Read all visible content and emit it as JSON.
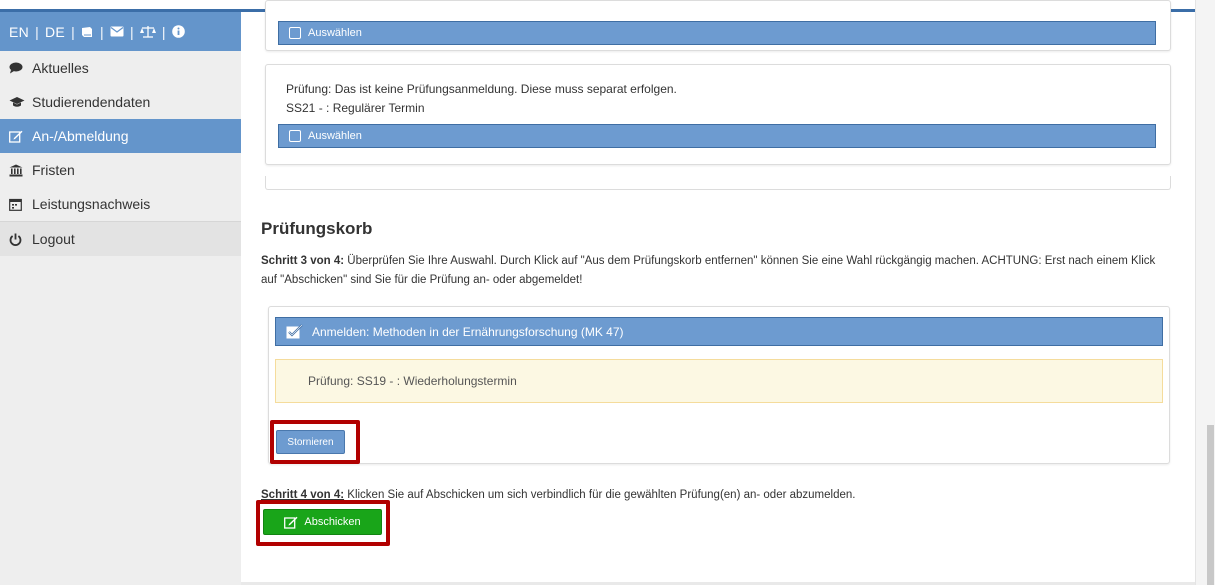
{
  "colors": {
    "accent_blue": "#6495cb",
    "button_blue": "#6d9bd0",
    "submit_green": "#19a519",
    "highlight_red": "#b10000",
    "warning_bg": "#fcf8e3"
  },
  "sidebar": {
    "lang": {
      "en": "EN",
      "de": "DE",
      "sep": "|",
      "icons": [
        "book-icon",
        "envelope-icon",
        "balance-scale-icon",
        "info-icon"
      ]
    },
    "items": [
      {
        "label": "Aktuelles",
        "icon": "comment-icon"
      },
      {
        "label": "Studierendendaten",
        "icon": "graduation-cap-icon"
      },
      {
        "label": "An-/Abmeldung",
        "icon": "edit-icon"
      },
      {
        "label": "Fristen",
        "icon": "bank-icon"
      },
      {
        "label": "Leistungsnachweis",
        "icon": "calendar-icon"
      },
      {
        "label": "Logout",
        "icon": "power-icon"
      }
    ]
  },
  "exam_cards": {
    "top_select_label": "Auswählen",
    "card2_line1": "Prüfung: Das ist keine Prüfungsanmeldung. Diese muss separat erfolgen.",
    "card2_line2": "SS21 - : Regulärer Termin",
    "card2_select_label": "Auswählen"
  },
  "basket": {
    "title": "Prüfungskorb",
    "step3_bold": "Schritt 3 von 4:",
    "step3_text": " Überprüfen Sie Ihre Auswahl. Durch Klick auf \"Aus dem Prüfungskorb entfernen\" können Sie eine Wahl rückgängig machen. ACHTUNG: Erst nach einem Klick",
    "step3_text2": "auf \"Abschicken\" sind Sie für die Prüfung an- oder abgemeldet!",
    "entry_header": "Anmelden: Methoden in der Ernährungsforschung (MK 47)",
    "entry_detail": "Prüfung: SS19 - : Wiederholungstermin",
    "cancel_button": "Stornieren",
    "step4_bold": "Schritt 4 von 4:",
    "step4_text": " Klicken Sie auf Abschicken um sich verbindlich für die gewählten Prüfung(en) an- oder abzumelden.",
    "submit_button": "Abschicken"
  }
}
